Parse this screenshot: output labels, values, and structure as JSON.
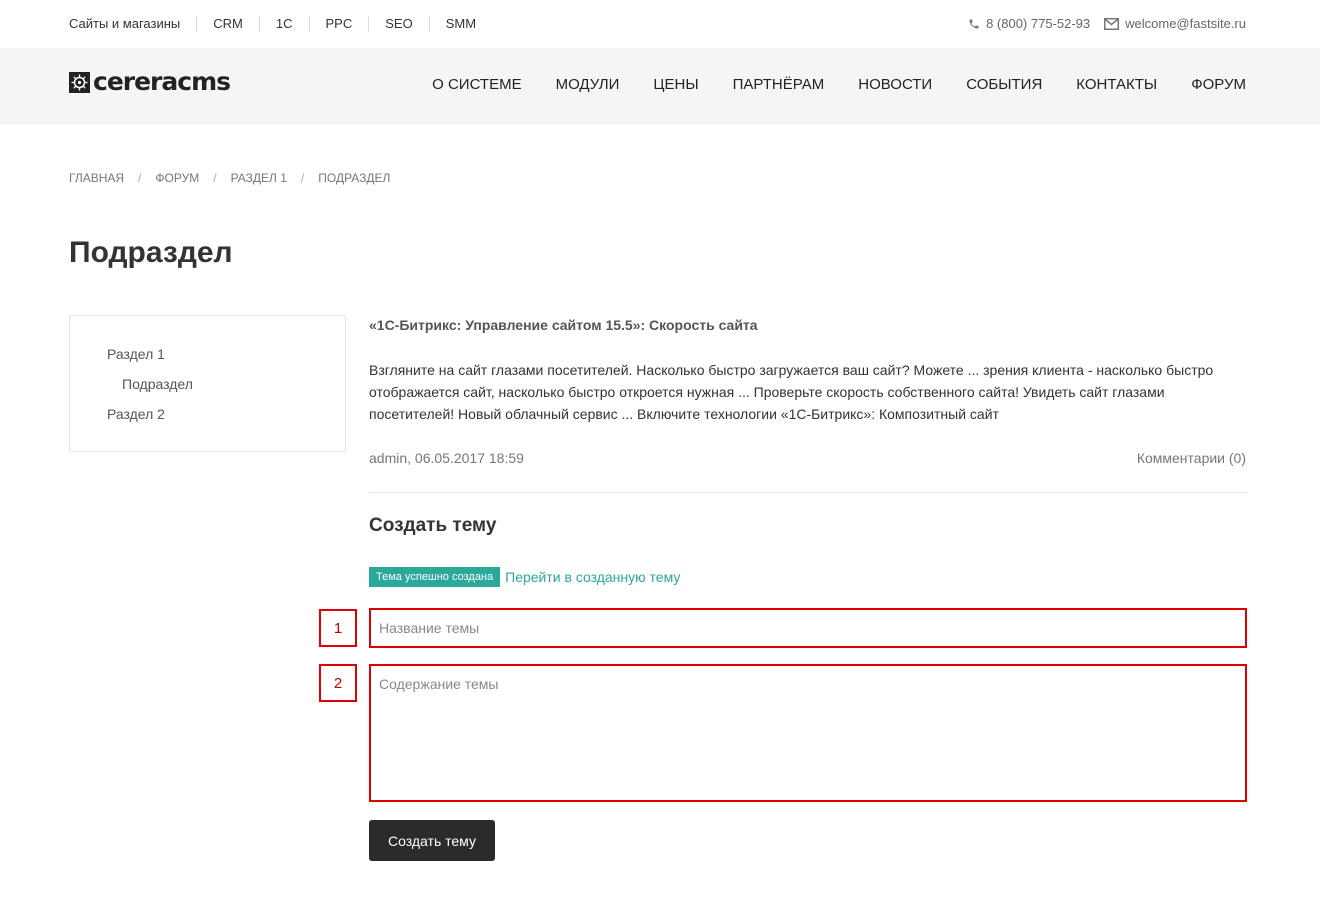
{
  "topbar": {
    "nav": [
      "Сайты и магазины",
      "CRM",
      "1С",
      "PPC",
      "SEO",
      "SMM"
    ],
    "phone": "8 (800) 775-52-93",
    "email": "welcome@fastsite.ru",
    "phone_icon": "phone-icon",
    "email_icon": "envelope-icon"
  },
  "header": {
    "logo_text": "cereracms",
    "nav": [
      "О системе",
      "Модули",
      "Цены",
      "Партнёрам",
      "Новости",
      "События",
      "Контакты",
      "Форум"
    ]
  },
  "breadcrumb": [
    "Главная",
    "Форум",
    "Раздел 1",
    "Подраздел"
  ],
  "page_title": "Подраздел",
  "sidebar": [
    {
      "label": "Раздел 1"
    },
    {
      "label": "Подраздел"
    },
    {
      "label": "Раздел 2"
    }
  ],
  "post": {
    "title": "«1С-Битрикс: Управление сайтом 15.5»: Скорость сайта",
    "body": "Взгляните на сайт глазами посетителей. Насколько быстро загружается ваш сайт? Можете ... зрения клиента - насколько быстро отображается сайт, насколько быстро откроется нужная ... Проверьте скорость собственного сайта! Увидеть сайт глазами посетителей! Новый облачный сервис ... Включите технологии «1С-Битрикс»: Композитный сайт",
    "meta": "admin, 06.05.2017 18:59",
    "comments": "Комментарии (0)"
  },
  "form": {
    "title": "Создать тему",
    "success_badge": "Тема успешно создана",
    "goto_link": "Перейти в созданную тему",
    "name_placeholder": "Название темы",
    "content_placeholder": "Содержание темы",
    "submit_label": "Создать тему",
    "marker_1": "1",
    "marker_2": "2"
  },
  "colors": {
    "accent": "#2aa89a",
    "highlight": "#e00000",
    "button": "#2b2b2b",
    "header_bg": "#f4f5f6"
  }
}
